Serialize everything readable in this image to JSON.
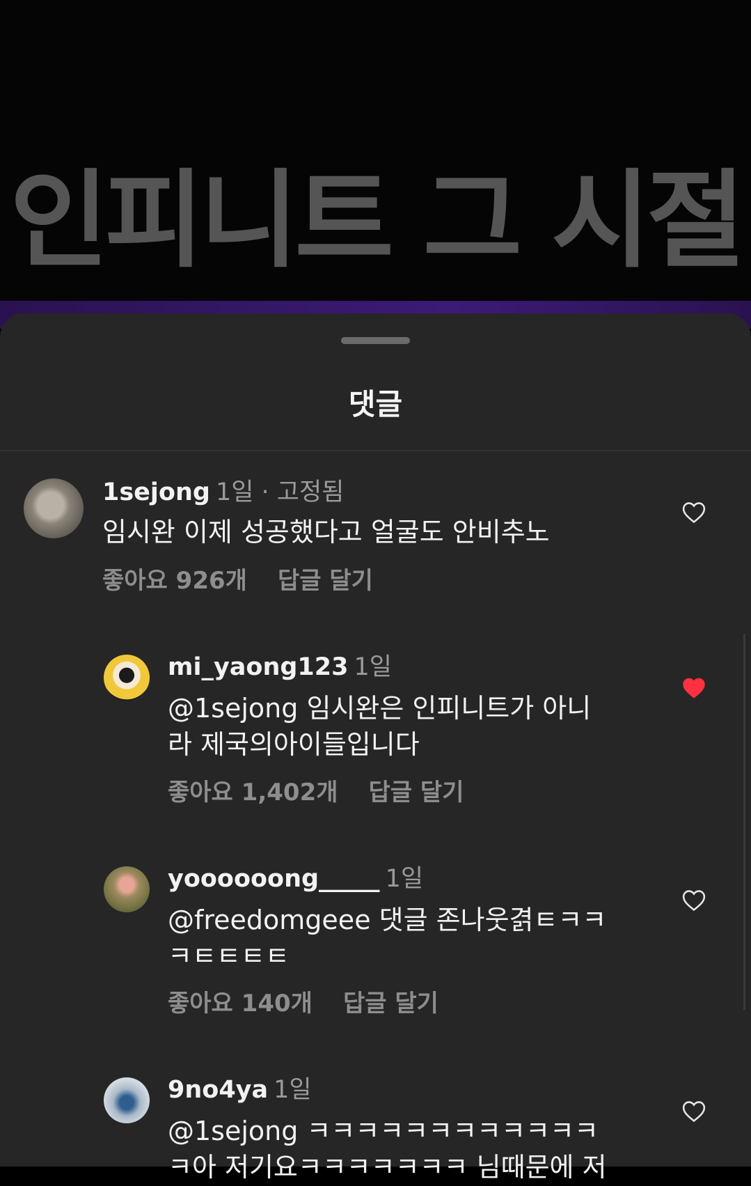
{
  "banner": {
    "title": "인피니트 그 시절"
  },
  "sheet": {
    "title": "댓글"
  },
  "comments": [
    {
      "username": "1sejong",
      "time": "1일",
      "pinned": " · 고정됨",
      "text": [
        "임시완 이제 성공했다고 얼굴도 안비추노"
      ],
      "likes": "좋아요 926개",
      "reply": "답글 달기",
      "liked": false
    },
    {
      "username": "mi_yaong123",
      "time": "1일",
      "text": [
        "@1sejong 임시완은 인피니트가 아니",
        "라 제국의아이들입니다"
      ],
      "likes": "좋아요 1,402개",
      "reply": "답글 달기",
      "liked": true
    },
    {
      "username": "yoooooong_____",
      "time": "1일",
      "text": [
        "@freedomgeee 댓글 존나웃겱ㅌㅋㅋ",
        "ㅋㅌㅌㅌㅌ"
      ],
      "likes": "좋아요 140개",
      "reply": "답글 달기",
      "liked": false
    },
    {
      "username": "9no4ya",
      "time": "1일",
      "text": [
        "@1sejong ㅋㅋㅋㅋㅋㅋㅋㅋㅋㅋㅋㅋ",
        "ㅋ아 저기요ㅋㅋㅋㅋㅋㅋㅋ 님때문에 저"
      ],
      "liked": false
    }
  ],
  "colors": {
    "like_red": "#ff3040",
    "sheet_bg": "#262626"
  }
}
